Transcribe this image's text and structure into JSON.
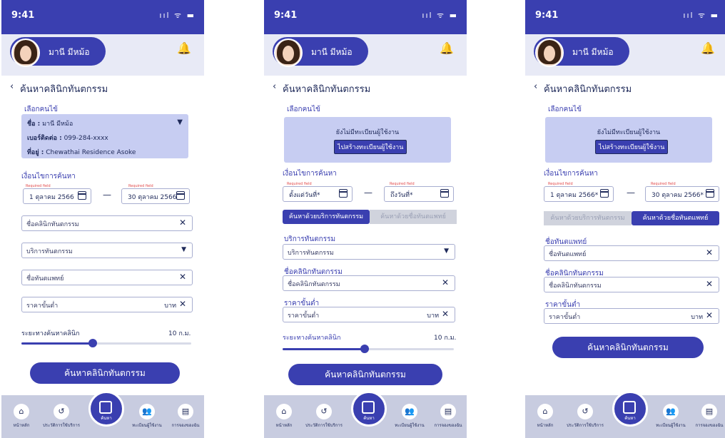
{
  "status": {
    "time": "9:41",
    "icons": "ııl ᯤ ▬"
  },
  "profile": {
    "name": "มานี มีหม้อ"
  },
  "page_title": "ค้นหาคลินิกทันตกรรม",
  "back_glyph": "‹",
  "select_patient_label": "เลือกคนไข้",
  "patient": {
    "name_label": "ชื่อ :",
    "name": "มานี มีหม้อ",
    "phone_label": "เบอร์ติดต่อ :",
    "phone": "099-284-xxxx",
    "addr_label": "ที่อยู่ :",
    "addr": "Chewathai Residence Asoke"
  },
  "no_user_msg": "ยังไม่มีทะเบียนผู้ใช้งาน",
  "create_user_btn": "ไปสร้างทะเบียนผู้ใช้งาน",
  "search_conditions_label": "เงื่อนไขการค้นหา",
  "required_field": "Required field",
  "screen1": {
    "date_from": "1 ตุลาคม 2566",
    "date_to": "30 ตุลาคม 2566",
    "clinic_name_ph": "ชื่อคลินิกทันตกรรม",
    "service_ph": "บริการทันตกรรม",
    "dentist_ph": "ชื่อทันตแพทย์",
    "min_price_ph": "ราคาขั้นต่ำ",
    "unit": "บาท",
    "distance_label": "ระยะทางค้นหาคลินิก",
    "distance_value": "10 ก.ม.",
    "distance_fraction": 0.42,
    "search_btn": "ค้นหาคลินิกทันตกรรม"
  },
  "screen2": {
    "date_from_ph": "ตั้งแต่วันที่*",
    "date_to_ph": "ถึงวันที่*",
    "tab_service": "ค้นหาด้วยบริการทันตกรรม",
    "tab_dentist": "ค้นหาด้วยชื่อทันตแพทย์",
    "service_label": "บริการทันตกรรม",
    "service_ph": "บริการทันตกรรม",
    "clinic_label": "ชื่อคลินิกทันตกรรม",
    "clinic_ph": "ชื่อคลินิกทันตกรรม",
    "min_price_label": "ราคาขั้นต่ำ",
    "min_price_ph": "ราคาขั้นต่ำ",
    "unit": "บาท",
    "distance_label": "ระยะทางค้นหาคลินิก",
    "distance_value": "10 ก.ม.",
    "distance_fraction": 0.48,
    "search_btn": "ค้นหาคลินิกทันตกรรม"
  },
  "screen3": {
    "date_from": "1 ตุลาคม 2566*",
    "date_to": "30 ตุลาคม 2566*",
    "tab_service": "ค้นหาด้วยบริการทันตกรรม",
    "tab_dentist": "ค้นหาด้วยชื่อทันตแพทย์",
    "dentist_label": "ชื่อทันตแพทย์",
    "dentist_ph": "ชื่อทันตแพทย์",
    "clinic_label": "ชื่อคลินิกทันตกรรม",
    "clinic_ph": "ชื่อคลินิกทันตกรรม",
    "min_price_label": "ราคาขั้นต่ำ",
    "min_price_ph": "ราคาขั้นต่ำ",
    "unit": "บาท",
    "search_btn": "ค้นหาคลินิกทันตกรรม"
  },
  "nav": {
    "home": "หน้าหลัก",
    "history": "ประวัติการใช้บริการ",
    "search": "ค้นหา",
    "register": "ทะเบียนผู้ใช้งาน",
    "booking": "การจองของฉัน"
  },
  "icons": {
    "home": "home-icon",
    "history": "history-icon",
    "calendar": "calendar-icon",
    "users": "users-icon",
    "booking": "booking-icon",
    "bell": "bell-icon",
    "clear": "clear-icon"
  },
  "colors": {
    "primary": "#3a3fb0",
    "card": "#c7cdf2",
    "nav": "#c8cce0",
    "required": "#e24b4b"
  }
}
